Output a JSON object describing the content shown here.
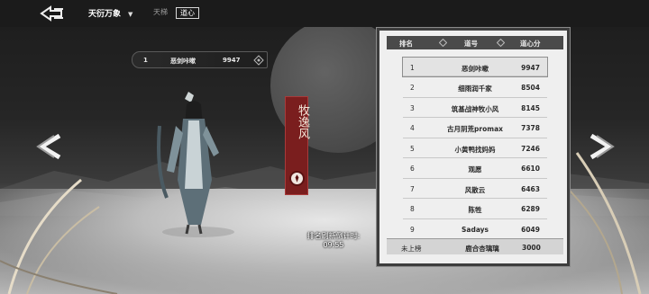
{
  "header": {
    "mode_label": "天衍万象",
    "tabs": [
      {
        "label": "天梯",
        "active": false
      },
      {
        "label": "道心",
        "active": true
      }
    ]
  },
  "my_rank": {
    "rank": "1",
    "name": "恶剑咔嗽",
    "score": "9947"
  },
  "character": {
    "name": "牧逸风"
  },
  "refresh": {
    "label": "排名刷新倒计时:",
    "time": "09:55"
  },
  "leaderboard": {
    "columns": [
      "排名",
      "道号",
      "道心分"
    ],
    "rows": [
      {
        "rank": "1",
        "name": "恶剑咔嗽",
        "score": "9947",
        "selected": true
      },
      {
        "rank": "2",
        "name": "细雨润千家",
        "score": "8504"
      },
      {
        "rank": "3",
        "name": "筑基战神牧小风",
        "score": "8145"
      },
      {
        "rank": "4",
        "name": "古月阴荒promax",
        "score": "7378"
      },
      {
        "rank": "5",
        "name": "小黄鸭找妈妈",
        "score": "7246"
      },
      {
        "rank": "6",
        "name": "观愿",
        "score": "6610"
      },
      {
        "rank": "7",
        "name": "风散云",
        "score": "6463"
      },
      {
        "rank": "8",
        "name": "陈牲",
        "score": "6289"
      },
      {
        "rank": "9",
        "name": "Sadays",
        "score": "6049"
      }
    ],
    "self": {
      "rank": "未上榜",
      "name": "鹿合杏璃璃",
      "score": "3000"
    }
  },
  "colors": {
    "banner": "#7a1e1e",
    "panel_bg": "#efefef",
    "panel_frame": "#3d3d3d"
  },
  "icons": [
    "back-arrow-icon",
    "chevron-down-icon",
    "chevron-left-icon",
    "chevron-right-icon",
    "diamond-ornament-icon",
    "seal-icon"
  ]
}
